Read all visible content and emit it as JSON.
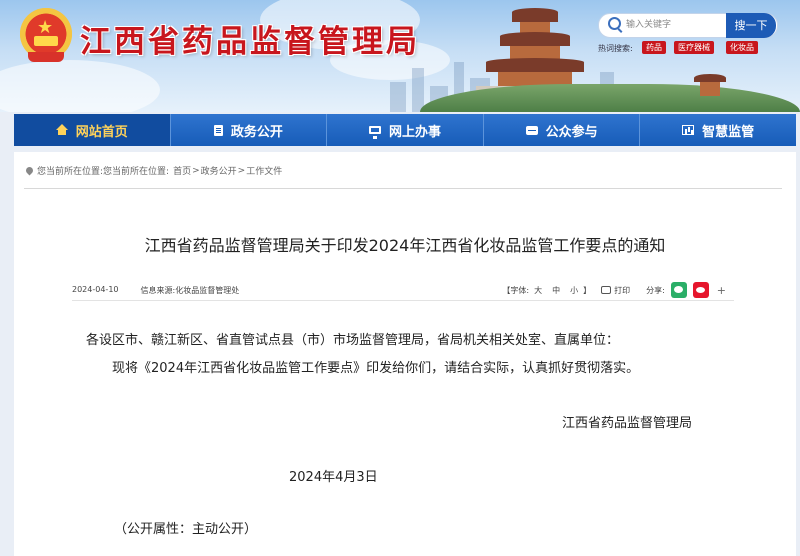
{
  "header": {
    "site_title": "江西省药品监督管理局",
    "search": {
      "placeholder": "输入关键字",
      "button_label": "搜一下",
      "hot_label": "热词搜索:",
      "hot_words": [
        "药品",
        "医疗器械",
        "化妆品"
      ]
    }
  },
  "nav": {
    "items": [
      {
        "label": "网站首页",
        "icon": "home-icon",
        "active": true
      },
      {
        "label": "政务公开",
        "icon": "document-icon",
        "active": false
      },
      {
        "label": "网上办事",
        "icon": "monitor-icon",
        "active": false
      },
      {
        "label": "公众参与",
        "icon": "chat-icon",
        "active": false
      },
      {
        "label": "智慧监管",
        "icon": "chart-icon",
        "active": false
      }
    ]
  },
  "breadcrumb": {
    "prefix": "您当前所在位置:",
    "items": [
      "首页",
      "政务公开",
      "工作文件"
    ],
    "separator": ">"
  },
  "article": {
    "title": "江西省药品监督管理局关于印发2024年江西省化妆品监管工作要点的通知",
    "date": "2024-04-10",
    "source_label": "信息来源:",
    "source": "化妆品监督管理处",
    "font_label": "【字体:",
    "font_sizes": [
      "大",
      "中",
      "小"
    ],
    "font_close": "】",
    "print_label": "打印",
    "share_label": "分享:",
    "share_more": "+",
    "paragraph_1": "各设区市、赣江新区、省直管试点县（市）市场监督管理局，省局机关相关处室、直属单位：",
    "paragraph_2": "现将《2024年江西省化妆品监管工作要点》印发给你们，请结合实际，认真抓好贯彻落实。",
    "signer": "江西省药品监督管理局",
    "sign_date": "2024年4月3日",
    "public_attribute": "（公开属性：主动公开）"
  },
  "colors": {
    "brand_red": "#c8161d",
    "nav_blue": "#175cb8",
    "nav_active": "#114c9f",
    "active_text": "#ffd25a"
  }
}
